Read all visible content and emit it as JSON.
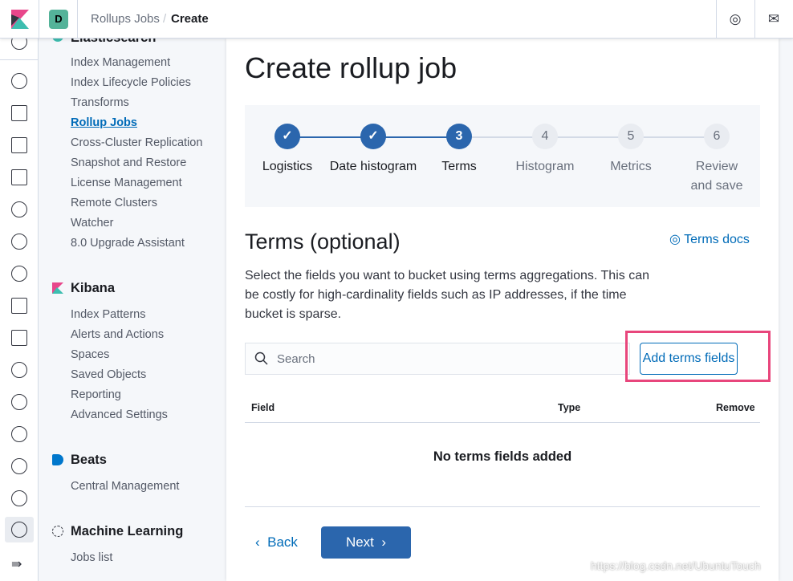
{
  "header": {
    "space_initial": "D",
    "breadcrumbs": [
      "Rollups Jobs",
      "Create"
    ],
    "icons": [
      "help-icon",
      "mail-icon"
    ]
  },
  "sidenav": {
    "sections": [
      {
        "title": "Elasticsearch",
        "items": [
          "Index Management",
          "Index Lifecycle Policies",
          "Transforms",
          "Rollup Jobs",
          "Cross-Cluster Replication",
          "Snapshot and Restore",
          "License Management",
          "Remote Clusters",
          "Watcher",
          "8.0 Upgrade Assistant"
        ],
        "active": "Rollup Jobs"
      },
      {
        "title": "Kibana",
        "items": [
          "Index Patterns",
          "Alerts and Actions",
          "Spaces",
          "Saved Objects",
          "Reporting",
          "Advanced Settings"
        ]
      },
      {
        "title": "Beats",
        "items": [
          "Central Management"
        ]
      },
      {
        "title": "Machine Learning",
        "items": [
          "Jobs list"
        ]
      }
    ]
  },
  "main": {
    "title": "Create rollup job",
    "steps": [
      {
        "number": "1",
        "label": "Logistics",
        "status": "complete"
      },
      {
        "number": "2",
        "label": "Date histogram",
        "status": "complete"
      },
      {
        "number": "3",
        "label": "Terms",
        "status": "current"
      },
      {
        "number": "4",
        "label": "Histogram",
        "status": "incomplete"
      },
      {
        "number": "5",
        "label": "Metrics",
        "status": "incomplete"
      },
      {
        "number": "6",
        "label": "Review and save",
        "status": "incomplete"
      }
    ],
    "section_title": "Terms (optional)",
    "docs_link": "Terms docs",
    "description": "Select the fields you want to bucket using terms aggregations. This can be costly for high-cardinality fields such as IP addresses, if the time bucket is sparse.",
    "search_placeholder": "Search",
    "add_button": "Add terms fields",
    "table": {
      "columns": [
        "Field",
        "Type",
        "Remove"
      ],
      "empty": "No terms fields added"
    },
    "back": "Back",
    "next": "Next"
  },
  "colors": {
    "primary": "#2b66ad",
    "link": "#006bb8",
    "highlight": "#e8467c"
  },
  "watermark": "https://blog.csdn.net/UbuntuTouch"
}
